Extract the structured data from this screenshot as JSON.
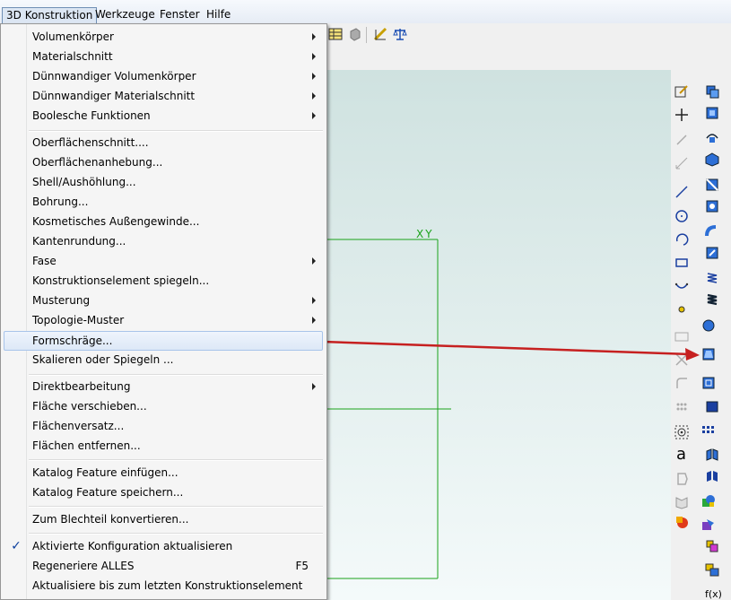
{
  "menubar": {
    "items": [
      {
        "label": "3D Konstruktion"
      },
      {
        "label": "Werkzeuge"
      },
      {
        "label": "Fenster"
      },
      {
        "label": "Hilfe"
      }
    ]
  },
  "menu": {
    "items": [
      {
        "label": "Volumenkörper"
      },
      {
        "label": "Materialschnitt"
      },
      {
        "label": "Dünnwandiger Volumenkörper"
      },
      {
        "label": "Dünnwandiger Materialschnitt"
      },
      {
        "label": "Boolesche Funktionen"
      },
      {
        "label": "Oberflächenschnitt...."
      },
      {
        "label": "Oberflächenanhebung..."
      },
      {
        "label": "Shell/Aushöhlung..."
      },
      {
        "label": "Bohrung..."
      },
      {
        "label": "Kosmetisches Außengewinde..."
      },
      {
        "label": "Kantenrundung..."
      },
      {
        "label": "Fase"
      },
      {
        "label": "Konstruktionselement spiegeln..."
      },
      {
        "label": "Musterung"
      },
      {
        "label": "Topologie-Muster"
      },
      {
        "label": "Formschräge..."
      },
      {
        "label": "Skalieren oder Spiegeln ..."
      },
      {
        "label": "Direktbearbeitung"
      },
      {
        "label": "Fläche verschieben..."
      },
      {
        "label": "Flächenversatz..."
      },
      {
        "label": "Flächen entfernen..."
      },
      {
        "label": "Katalog Feature einfügen..."
      },
      {
        "label": "Katalog Feature speichern..."
      },
      {
        "label": "Zum Blechteil konvertieren..."
      },
      {
        "label": "Aktivierte Konfiguration aktualisieren",
        "check": "✓"
      },
      {
        "label": "Regeneriere ALLES",
        "shortcut": "F5"
      },
      {
        "label": "Aktualisiere bis zum letzten Konstruktionselement"
      }
    ]
  },
  "viewport": {
    "plane_label": "XY"
  },
  "rtools": {
    "fx_label": "f(x)"
  }
}
